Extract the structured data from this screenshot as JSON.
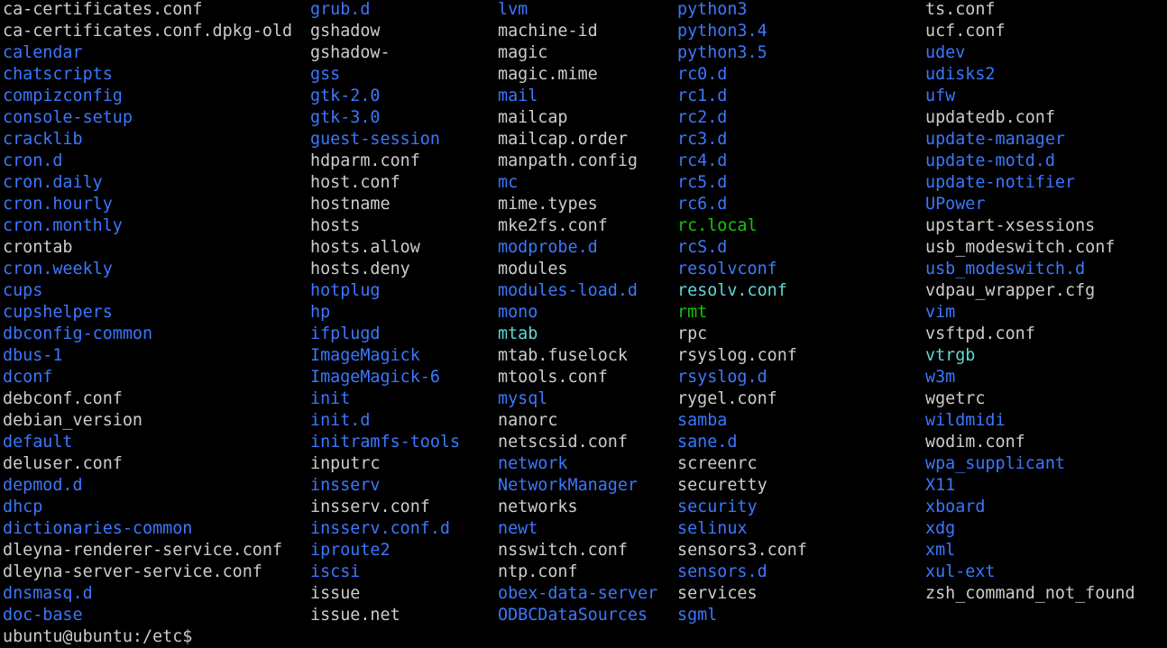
{
  "theme": {
    "background": "#000000",
    "foreground": "#cccccc",
    "directory": "#3b78ff",
    "executable": "#16c60c",
    "symlink": "#61d6d6"
  },
  "columns": [
    [
      {
        "name": "ca-certificates.conf",
        "type": "file"
      },
      {
        "name": "ca-certificates.conf.dpkg-old",
        "type": "file"
      },
      {
        "name": "calendar",
        "type": "dir"
      },
      {
        "name": "chatscripts",
        "type": "dir"
      },
      {
        "name": "compizconfig",
        "type": "dir"
      },
      {
        "name": "console-setup",
        "type": "dir"
      },
      {
        "name": "cracklib",
        "type": "dir"
      },
      {
        "name": "cron.d",
        "type": "dir"
      },
      {
        "name": "cron.daily",
        "type": "dir"
      },
      {
        "name": "cron.hourly",
        "type": "dir"
      },
      {
        "name": "cron.monthly",
        "type": "dir"
      },
      {
        "name": "crontab",
        "type": "file"
      },
      {
        "name": "cron.weekly",
        "type": "dir"
      },
      {
        "name": "cups",
        "type": "dir"
      },
      {
        "name": "cupshelpers",
        "type": "dir"
      },
      {
        "name": "dbconfig-common",
        "type": "dir"
      },
      {
        "name": "dbus-1",
        "type": "dir"
      },
      {
        "name": "dconf",
        "type": "dir"
      },
      {
        "name": "debconf.conf",
        "type": "file"
      },
      {
        "name": "debian_version",
        "type": "file"
      },
      {
        "name": "default",
        "type": "dir"
      },
      {
        "name": "deluser.conf",
        "type": "file"
      },
      {
        "name": "depmod.d",
        "type": "dir"
      },
      {
        "name": "dhcp",
        "type": "dir"
      },
      {
        "name": "dictionaries-common",
        "type": "dir"
      },
      {
        "name": "dleyna-renderer-service.conf",
        "type": "file"
      },
      {
        "name": "dleyna-server-service.conf",
        "type": "file"
      },
      {
        "name": "dnsmasq.d",
        "type": "dir"
      },
      {
        "name": "doc-base",
        "type": "dir"
      }
    ],
    [
      {
        "name": "grub.d",
        "type": "dir"
      },
      {
        "name": "gshadow",
        "type": "file"
      },
      {
        "name": "gshadow-",
        "type": "file"
      },
      {
        "name": "gss",
        "type": "dir"
      },
      {
        "name": "gtk-2.0",
        "type": "dir"
      },
      {
        "name": "gtk-3.0",
        "type": "dir"
      },
      {
        "name": "guest-session",
        "type": "dir"
      },
      {
        "name": "hdparm.conf",
        "type": "file"
      },
      {
        "name": "host.conf",
        "type": "file"
      },
      {
        "name": "hostname",
        "type": "file"
      },
      {
        "name": "hosts",
        "type": "file"
      },
      {
        "name": "hosts.allow",
        "type": "file"
      },
      {
        "name": "hosts.deny",
        "type": "file"
      },
      {
        "name": "hotplug",
        "type": "dir"
      },
      {
        "name": "hp",
        "type": "dir"
      },
      {
        "name": "ifplugd",
        "type": "dir"
      },
      {
        "name": "ImageMagick",
        "type": "dir"
      },
      {
        "name": "ImageMagick-6",
        "type": "dir"
      },
      {
        "name": "init",
        "type": "dir"
      },
      {
        "name": "init.d",
        "type": "dir"
      },
      {
        "name": "initramfs-tools",
        "type": "dir"
      },
      {
        "name": "inputrc",
        "type": "file"
      },
      {
        "name": "insserv",
        "type": "dir"
      },
      {
        "name": "insserv.conf",
        "type": "file"
      },
      {
        "name": "insserv.conf.d",
        "type": "dir"
      },
      {
        "name": "iproute2",
        "type": "dir"
      },
      {
        "name": "iscsi",
        "type": "dir"
      },
      {
        "name": "issue",
        "type": "file"
      },
      {
        "name": "issue.net",
        "type": "file"
      }
    ],
    [
      {
        "name": "lvm",
        "type": "dir"
      },
      {
        "name": "machine-id",
        "type": "file"
      },
      {
        "name": "magic",
        "type": "file"
      },
      {
        "name": "magic.mime",
        "type": "file"
      },
      {
        "name": "mail",
        "type": "dir"
      },
      {
        "name": "mailcap",
        "type": "file"
      },
      {
        "name": "mailcap.order",
        "type": "file"
      },
      {
        "name": "manpath.config",
        "type": "file"
      },
      {
        "name": "mc",
        "type": "dir"
      },
      {
        "name": "mime.types",
        "type": "file"
      },
      {
        "name": "mke2fs.conf",
        "type": "file"
      },
      {
        "name": "modprobe.d",
        "type": "dir"
      },
      {
        "name": "modules",
        "type": "file"
      },
      {
        "name": "modules-load.d",
        "type": "dir"
      },
      {
        "name": "mono",
        "type": "dir"
      },
      {
        "name": "mtab",
        "type": "link"
      },
      {
        "name": "mtab.fuselock",
        "type": "file"
      },
      {
        "name": "mtools.conf",
        "type": "file"
      },
      {
        "name": "mysql",
        "type": "dir"
      },
      {
        "name": "nanorc",
        "type": "file"
      },
      {
        "name": "netscsid.conf",
        "type": "file"
      },
      {
        "name": "network",
        "type": "dir"
      },
      {
        "name": "NetworkManager",
        "type": "dir"
      },
      {
        "name": "networks",
        "type": "file"
      },
      {
        "name": "newt",
        "type": "dir"
      },
      {
        "name": "nsswitch.conf",
        "type": "file"
      },
      {
        "name": "ntp.conf",
        "type": "file"
      },
      {
        "name": "obex-data-server",
        "type": "dir"
      },
      {
        "name": "ODBCDataSources",
        "type": "dir"
      }
    ],
    [
      {
        "name": "python3",
        "type": "dir"
      },
      {
        "name": "python3.4",
        "type": "dir"
      },
      {
        "name": "python3.5",
        "type": "dir"
      },
      {
        "name": "rc0.d",
        "type": "dir"
      },
      {
        "name": "rc1.d",
        "type": "dir"
      },
      {
        "name": "rc2.d",
        "type": "dir"
      },
      {
        "name": "rc3.d",
        "type": "dir"
      },
      {
        "name": "rc4.d",
        "type": "dir"
      },
      {
        "name": "rc5.d",
        "type": "dir"
      },
      {
        "name": "rc6.d",
        "type": "dir"
      },
      {
        "name": "rc.local",
        "type": "exec"
      },
      {
        "name": "rcS.d",
        "type": "dir"
      },
      {
        "name": "resolvconf",
        "type": "dir"
      },
      {
        "name": "resolv.conf",
        "type": "link"
      },
      {
        "name": "rmt",
        "type": "exec"
      },
      {
        "name": "rpc",
        "type": "file"
      },
      {
        "name": "rsyslog.conf",
        "type": "file"
      },
      {
        "name": "rsyslog.d",
        "type": "dir"
      },
      {
        "name": "rygel.conf",
        "type": "file"
      },
      {
        "name": "samba",
        "type": "dir"
      },
      {
        "name": "sane.d",
        "type": "dir"
      },
      {
        "name": "screenrc",
        "type": "file"
      },
      {
        "name": "securetty",
        "type": "file"
      },
      {
        "name": "security",
        "type": "dir"
      },
      {
        "name": "selinux",
        "type": "dir"
      },
      {
        "name": "sensors3.conf",
        "type": "file"
      },
      {
        "name": "sensors.d",
        "type": "dir"
      },
      {
        "name": "services",
        "type": "file"
      },
      {
        "name": "sgml",
        "type": "dir"
      }
    ],
    [
      {
        "name": "ts.conf",
        "type": "file"
      },
      {
        "name": "ucf.conf",
        "type": "file"
      },
      {
        "name": "udev",
        "type": "dir"
      },
      {
        "name": "udisks2",
        "type": "dir"
      },
      {
        "name": "ufw",
        "type": "dir"
      },
      {
        "name": "updatedb.conf",
        "type": "file"
      },
      {
        "name": "update-manager",
        "type": "dir"
      },
      {
        "name": "update-motd.d",
        "type": "dir"
      },
      {
        "name": "update-notifier",
        "type": "dir"
      },
      {
        "name": "UPower",
        "type": "dir"
      },
      {
        "name": "upstart-xsessions",
        "type": "file"
      },
      {
        "name": "usb_modeswitch.conf",
        "type": "file"
      },
      {
        "name": "usb_modeswitch.d",
        "type": "dir"
      },
      {
        "name": "vdpau_wrapper.cfg",
        "type": "file"
      },
      {
        "name": "vim",
        "type": "dir"
      },
      {
        "name": "vsftpd.conf",
        "type": "file"
      },
      {
        "name": "vtrgb",
        "type": "link"
      },
      {
        "name": "w3m",
        "type": "dir"
      },
      {
        "name": "wgetrc",
        "type": "file"
      },
      {
        "name": "wildmidi",
        "type": "dir"
      },
      {
        "name": "wodim.conf",
        "type": "file"
      },
      {
        "name": "wpa_supplicant",
        "type": "dir"
      },
      {
        "name": "X11",
        "type": "dir"
      },
      {
        "name": "xboard",
        "type": "dir"
      },
      {
        "name": "xdg",
        "type": "dir"
      },
      {
        "name": "xml",
        "type": "dir"
      },
      {
        "name": "xul-ext",
        "type": "dir"
      },
      {
        "name": "zsh_command_not_found",
        "type": "file"
      }
    ]
  ],
  "prompt": {
    "text": "ubuntu@ubuntu:/etc$"
  }
}
